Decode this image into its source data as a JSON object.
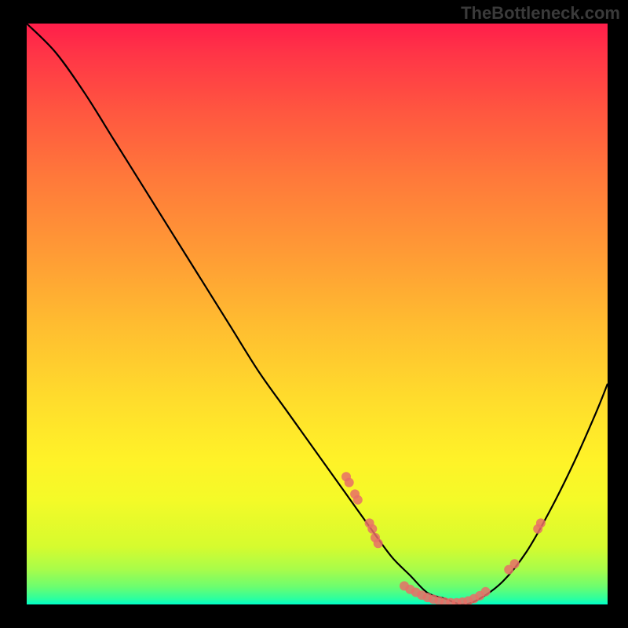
{
  "watermark": "TheBottleneck.com",
  "chart_data": {
    "type": "line",
    "title": "",
    "xlabel": "",
    "ylabel": "",
    "xlim": [
      0,
      100
    ],
    "ylim": [
      0,
      100
    ],
    "background": "heatmap-gradient",
    "gradient_stops": [
      {
        "pos": 0,
        "color": "#ff1e4a"
      },
      {
        "pos": 15,
        "color": "#ff5640"
      },
      {
        "pos": 40,
        "color": "#ff9c35"
      },
      {
        "pos": 65,
        "color": "#ffdd2c"
      },
      {
        "pos": 82,
        "color": "#f4fa28"
      },
      {
        "pos": 94,
        "color": "#a8fc4a"
      },
      {
        "pos": 100,
        "color": "#00ffc8"
      }
    ],
    "series": [
      {
        "name": "bottleneck-curve",
        "x": [
          0,
          5,
          10,
          15,
          20,
          25,
          30,
          35,
          40,
          45,
          50,
          55,
          60,
          63,
          66,
          69,
          72,
          75,
          78,
          82,
          86,
          90,
          94,
          98,
          100
        ],
        "y": [
          100,
          95,
          88,
          80,
          72,
          64,
          56,
          48,
          40,
          33,
          26,
          19,
          12,
          8,
          5,
          2,
          1,
          0,
          1,
          4,
          9,
          16,
          24,
          33,
          38
        ]
      }
    ],
    "markers": [
      {
        "x": 55,
        "y": 22
      },
      {
        "x": 55.5,
        "y": 21
      },
      {
        "x": 56.5,
        "y": 19
      },
      {
        "x": 57,
        "y": 18
      },
      {
        "x": 59,
        "y": 14
      },
      {
        "x": 59.5,
        "y": 13
      },
      {
        "x": 60,
        "y": 11.5
      },
      {
        "x": 60.5,
        "y": 10.5
      },
      {
        "x": 65,
        "y": 3.2
      },
      {
        "x": 66,
        "y": 2.6
      },
      {
        "x": 67,
        "y": 2.1
      },
      {
        "x": 68,
        "y": 1.6
      },
      {
        "x": 69,
        "y": 1.2
      },
      {
        "x": 70,
        "y": 0.9
      },
      {
        "x": 71,
        "y": 0.6
      },
      {
        "x": 72,
        "y": 0.4
      },
      {
        "x": 73,
        "y": 0.3
      },
      {
        "x": 74,
        "y": 0.3
      },
      {
        "x": 75,
        "y": 0.4
      },
      {
        "x": 76,
        "y": 0.6
      },
      {
        "x": 77,
        "y": 1.0
      },
      {
        "x": 78,
        "y": 1.5
      },
      {
        "x": 79,
        "y": 2.2
      },
      {
        "x": 83,
        "y": 6
      },
      {
        "x": 84,
        "y": 7
      },
      {
        "x": 88,
        "y": 13
      },
      {
        "x": 88.5,
        "y": 14
      }
    ],
    "marker_style": {
      "color": "#e86e67",
      "radius_px": 6
    }
  }
}
